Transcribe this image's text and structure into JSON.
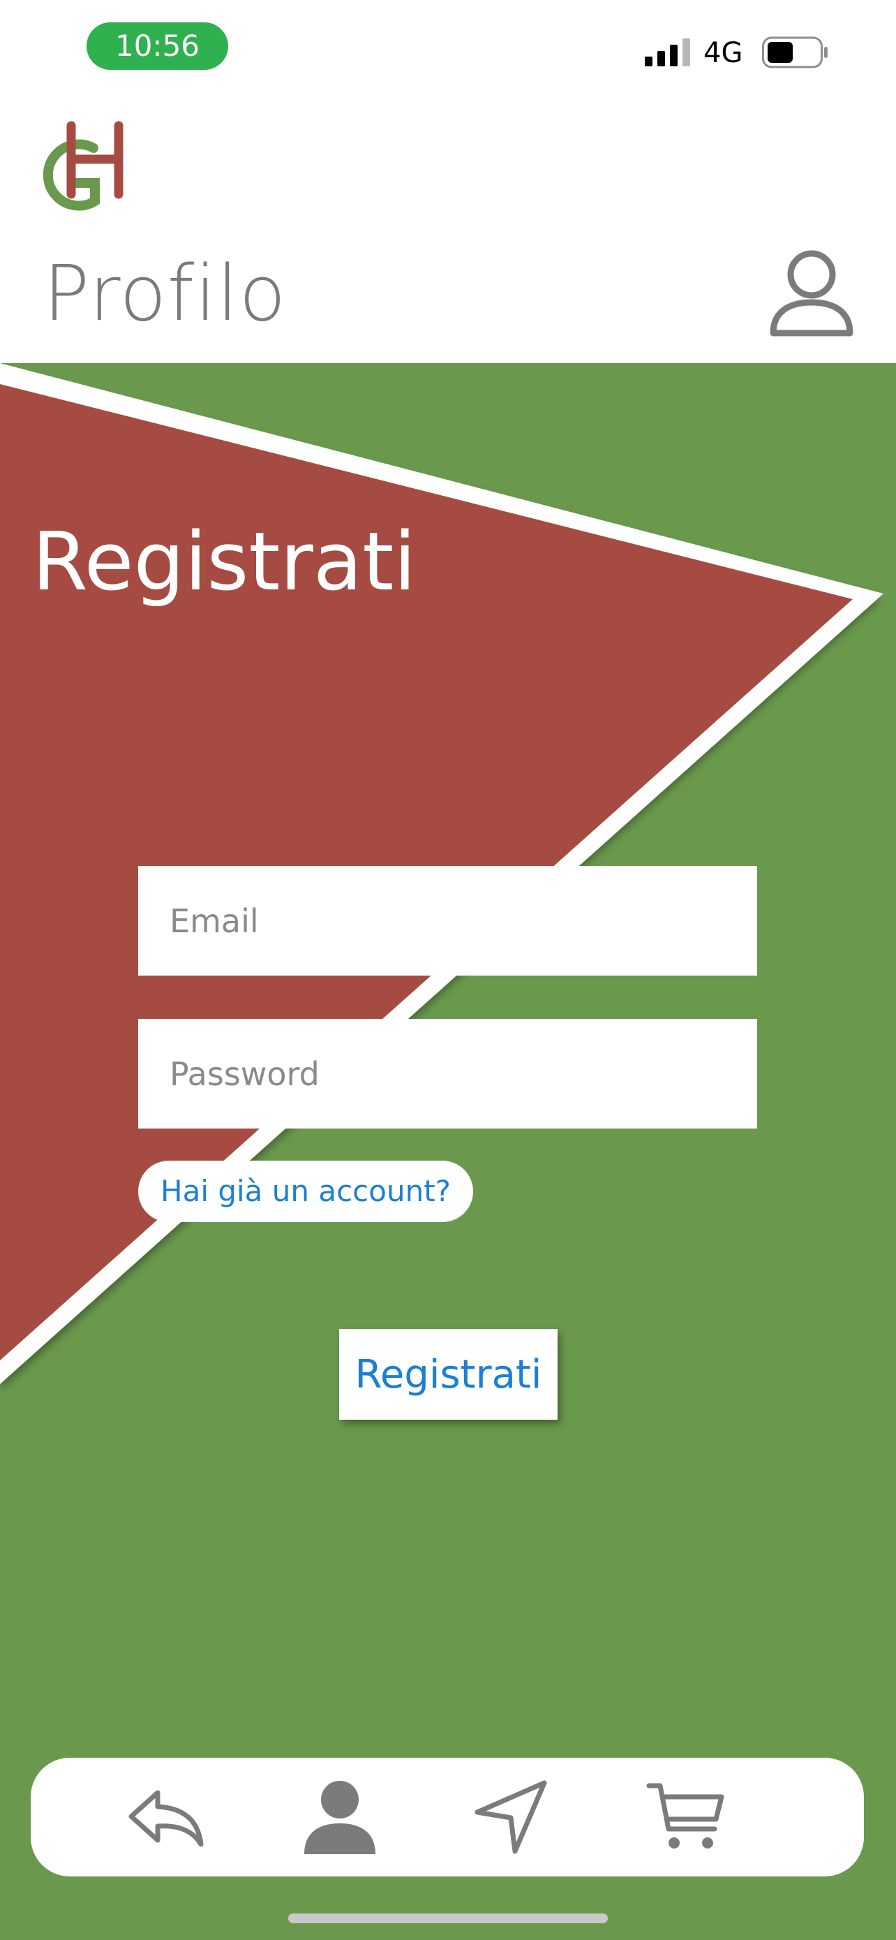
{
  "status_bar": {
    "time": "10:56",
    "network": "4G",
    "time_pill_color": "#2fb14f",
    "battery_level": 0.5
  },
  "header": {
    "logo_icon": "gh-monogram-logo",
    "title": "Profilo",
    "profile_icon": "user-outline-icon"
  },
  "form": {
    "title": "Registrati",
    "email_placeholder": "Email",
    "password_placeholder": "Password",
    "account_link": "Hai già un account?",
    "submit_label": "Registrati"
  },
  "bottom_nav": {
    "items": [
      {
        "name": "back",
        "icon": "reply-arrow-icon"
      },
      {
        "name": "profile",
        "icon": "user-filled-icon",
        "active": true
      },
      {
        "name": "location",
        "icon": "navigation-arrow-icon"
      },
      {
        "name": "cart",
        "icon": "shopping-cart-icon"
      }
    ]
  },
  "colors": {
    "green": "#6a994d",
    "red": "#a64b41",
    "link_blue": "#1b7fd6",
    "gray_text": "#7b7b7b"
  }
}
